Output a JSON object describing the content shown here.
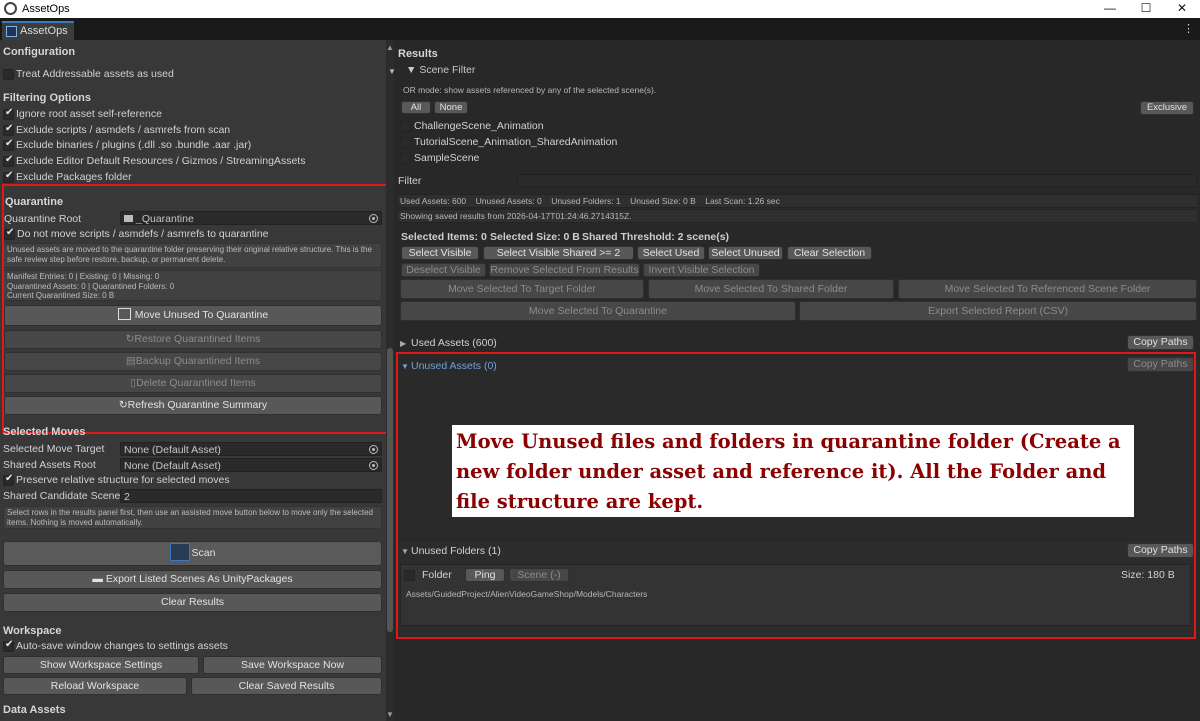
{
  "window": {
    "title": "AssetOps",
    "minimize": "—",
    "maximize": "☐",
    "close": "✕"
  },
  "tab": {
    "label": "AssetOps",
    "menu": "⋮"
  },
  "left": {
    "config_header": "Configuration",
    "treat_addressable": "Treat Addressable assets as used",
    "filtering_header": "Filtering Options",
    "filters": [
      "Ignore root asset self-reference",
      "Exclude scripts / asmdefs / asmrefs from scan",
      "Exclude binaries / plugins (.dll .so .bundle .aar .jar)",
      "Exclude Editor Default Resources / Gizmos / StreamingAssets",
      "Exclude Packages folder"
    ],
    "quarantine": {
      "header": "Quarantine",
      "root_label": "Quarantine Root",
      "root_value": "_Quarantine",
      "no_move_scripts": "Do not move scripts / asmdefs / asmrefs to quarantine",
      "help": "Unused assets are moved to the quarantine folder preserving their original relative structure. This is the safe review step before restore, backup, or permanent delete.",
      "summary_1": "Manifest Entries: 0  |  Existing: 0  |  Missing: 0",
      "summary_2": "Quarantined Assets: 0  |  Quarantined Folders: 0",
      "summary_3": "Current Quarantined Size: 0 B",
      "move_unused": "Move Unused To Quarantine",
      "restore": "Restore Quarantined Items",
      "backup": "Backup Quarantined Items",
      "delete": "Delete Quarantined Items",
      "refresh": "Refresh Quarantine Summary"
    },
    "selected_moves": {
      "header": "Selected Moves",
      "target_label": "Selected Move Target",
      "target_value": "None (Default Asset)",
      "shared_label": "Shared Assets Root",
      "shared_value": "None (Default Asset)",
      "preserve": "Preserve relative structure for selected moves",
      "candidate_label": "Shared Candidate Scene C",
      "candidate_value": "2",
      "help": "Select rows in the results panel first, then use an assisted move button below to move only the selected items. Nothing is moved automatically."
    },
    "scan": "Scan",
    "export_scenes": "Export Listed Scenes As UnityPackages",
    "clear_results": "Clear Results",
    "workspace": {
      "header": "Workspace",
      "autosave": "Auto-save window changes to settings assets",
      "show": "Show Workspace Settings",
      "save": "Save Workspace Now",
      "reload": "Reload Workspace",
      "clear_saved": "Clear Saved Results"
    },
    "data_assets_header": "Data Assets"
  },
  "right": {
    "results_header": "Results",
    "scene_filter": "Scene Filter",
    "or_mode": "OR mode: show assets referenced by any of the selected scene(s).",
    "all": "All",
    "none": "None",
    "exclusive": "Exclusive",
    "scenes": [
      "ChallengeScene_Animation",
      "TutorialScene_Animation_SharedAnimation",
      "SampleScene"
    ],
    "filter_label": "Filter",
    "filter_value": "",
    "stats": "Used Assets: 600    Unused Assets: 0    Unused Folders: 1    Unused Size: 0 B    Last Scan: 1.26 sec",
    "saved": "Showing saved results from 2026-04-17T01:24:46.2714315Z.",
    "sel_items": "Selected Items: 0",
    "sel_size": "Selected Size: 0 B",
    "shared_threshold": "Shared Threshold: 2 scene(s)",
    "sel_buttons": [
      "Select Visible",
      "Select Visible Shared >= 2",
      "Select Used",
      "Select Unused",
      "Clear Selection"
    ],
    "dis_buttons": [
      "Deselect Visible",
      "Remove Selected From Results",
      "Invert Visible Selection"
    ],
    "move_buttons": [
      "Move Selected To Target Folder",
      "Move Selected To Shared Folder",
      "Move Selected To Referenced Scene Folder"
    ],
    "move_quarantine": "Move Selected To Quarantine",
    "export_report": "Export Selected Report (CSV)",
    "used_assets": "Used Assets (600)",
    "unused_assets": "Unused Assets (0)",
    "unused_folders": "Unused Folders (1)",
    "copy_paths": "Copy Paths",
    "folder_row": {
      "type": "Folder",
      "ping": "Ping",
      "scene": "Scene (-)",
      "size": "Size: 180 B",
      "path": "Assets/GuidedProject/AlienVideoGameShop/Models/Characters"
    }
  },
  "annotation": "Move Unused files and folders in quarantine folder (Create a new folder under asset and reference it). All the Folder and file structure are kept.",
  "colors": {
    "accent": "#3a79bb",
    "highlight_red": "#e01818",
    "annotation_text": "#8b0000",
    "unused_header": "#6fa0dc"
  }
}
